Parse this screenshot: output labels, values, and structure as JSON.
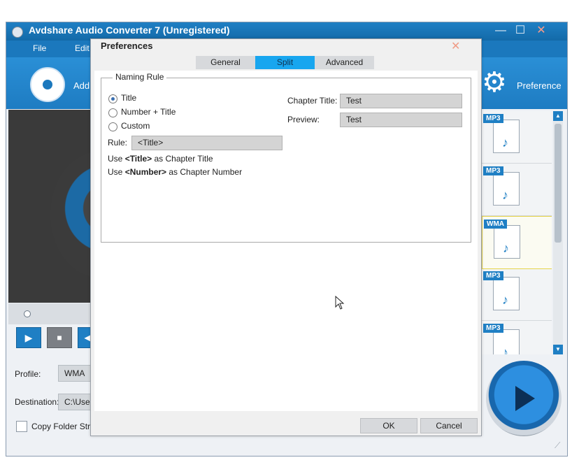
{
  "app": {
    "title": "Avdshare Audio Converter 7 (Unregistered)",
    "minimize_glyph": "—",
    "maximize_glyph": "☐",
    "close_glyph": "✕"
  },
  "menu": [
    {
      "label": "File"
    },
    {
      "label": "Edit"
    }
  ],
  "toolbar": {
    "add_label": "Add",
    "preference_label": "Preference"
  },
  "player": {
    "play_glyph": "▶",
    "stop_glyph": "■",
    "prev_glyph": "◀"
  },
  "bottom": {
    "profile_label": "Profile:",
    "profile_value": "WMA",
    "destination_label": "Destination:",
    "destination_value": "C:\\Users",
    "copy_folder_label": "Copy Folder Structure"
  },
  "files": [
    {
      "format": "MP3"
    },
    {
      "format": "MP3"
    },
    {
      "format": "WMA"
    },
    {
      "format": "MP3"
    },
    {
      "format": "MP3"
    }
  ],
  "preferences": {
    "title": "Preferences",
    "close_glyph": "✕",
    "tabs": [
      {
        "label": "General",
        "active": false
      },
      {
        "label": "Split",
        "active": true
      },
      {
        "label": "Advanced",
        "active": false
      }
    ],
    "naming_rule": {
      "legend": "Naming Rule",
      "options": [
        {
          "label": "Title",
          "checked": true
        },
        {
          "label": "Number + Title",
          "checked": false
        },
        {
          "label": "Custom",
          "checked": false
        }
      ],
      "rule_label": "Rule:",
      "rule_value": "<Title>",
      "help_lines": [
        {
          "prefix": "Use ",
          "token": "<Title>",
          "suffix": " as Chapter Title"
        },
        {
          "prefix": "Use ",
          "token": "<Number>",
          "suffix": " as Chapter Number"
        }
      ],
      "chapter_title_label": "Chapter Title:",
      "chapter_title_value": "Test",
      "preview_label": "Preview:",
      "preview_value": "Test"
    },
    "ok_label": "OK",
    "cancel_label": "Cancel"
  },
  "colors": {
    "accent": "#1f7fc4",
    "active_tab": "#18a6ef"
  }
}
